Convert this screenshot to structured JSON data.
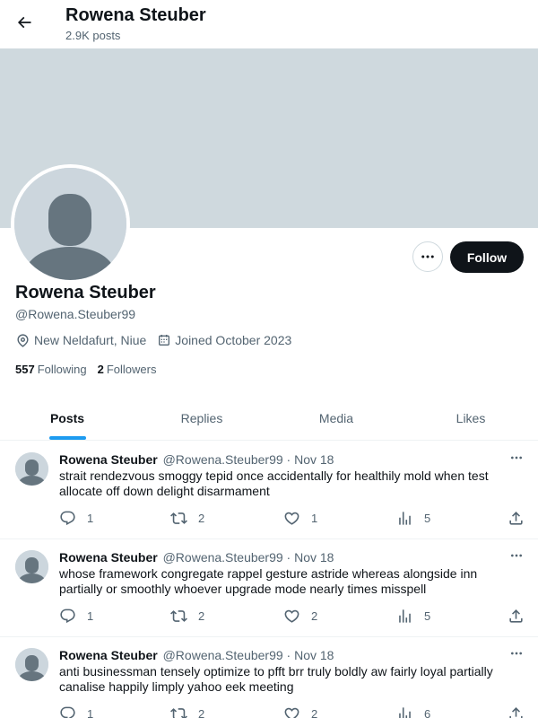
{
  "header": {
    "title": "Rowena Steuber",
    "subtitle": "2.9K posts"
  },
  "profile": {
    "name": "Rowena Steuber",
    "handle": "@Rowena.Steuber99",
    "location": "New Neldafurt, Niue",
    "joined": "Joined October 2023",
    "following_count": "557",
    "following_label": "Following",
    "followers_count": "2",
    "followers_label": "Followers",
    "follow_label": "Follow"
  },
  "tabs": [
    {
      "label": "Posts",
      "active": true
    },
    {
      "label": "Replies"
    },
    {
      "label": "Media"
    },
    {
      "label": "Likes"
    }
  ],
  "posts": [
    {
      "name": "Rowena Steuber",
      "handle_date": "@Rowena.Steuber99 · Nov 18",
      "text": "strait rendezvous smoggy tepid once accidentally for healthily mold when test allocate off down delight disarmament",
      "replies": "1",
      "reposts": "2",
      "likes": "1",
      "views": "5"
    },
    {
      "name": "Rowena Steuber",
      "handle_date": "@Rowena.Steuber99 · Nov 18",
      "text": "whose framework congregate rappel gesture astride whereas alongside inn partially or smoothly whoever upgrade mode nearly times misspell",
      "replies": "1",
      "reposts": "2",
      "likes": "2",
      "views": "5"
    },
    {
      "name": "Rowena Steuber",
      "handle_date": "@Rowena.Steuber99 · Nov 18",
      "text": "anti businessman tensely optimize to pfft brr truly boldly aw fairly loyal partially canalise happily limply yahoo eek meeting",
      "replies": "1",
      "reposts": "2",
      "likes": "2",
      "views": "6"
    }
  ],
  "colors": {
    "accent": "#1d9bf0",
    "banner": "#cfd9de",
    "text": "#0f1419",
    "muted": "#536471"
  }
}
